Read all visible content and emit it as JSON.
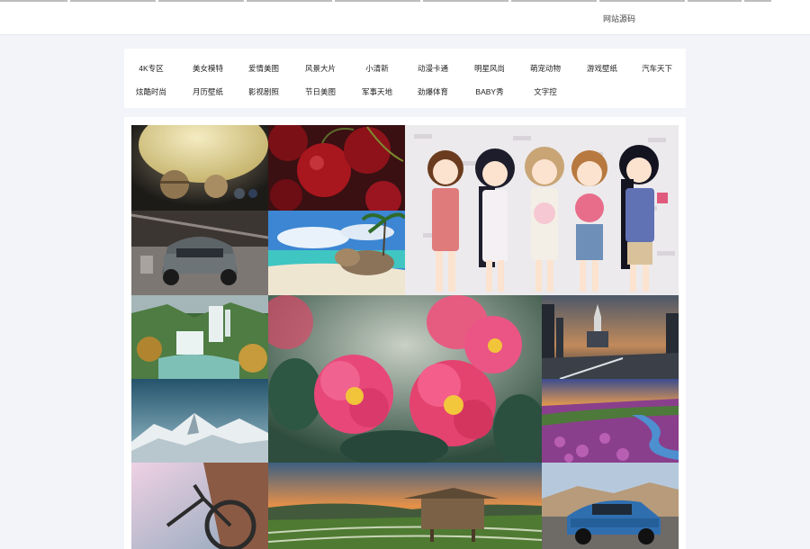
{
  "header": {
    "source_link": "网站源码"
  },
  "categories": [
    "4K专区",
    "美女模特",
    "爱情美图",
    "风景大片",
    "小清新",
    "动漫卡通",
    "明星风尚",
    "萌宠动物",
    "游戏壁纸",
    "汽车天下",
    "炫酷时尚",
    "月历壁纸",
    "影视剧照",
    "节日美图",
    "军事天地",
    "劲爆体育",
    "BABY秀",
    "文字控"
  ],
  "gallery": {
    "tiles": [
      {
        "name": "planets-wallpaper",
        "icon": "planets-image"
      },
      {
        "name": "cherries-wallpaper",
        "icon": "cherries-image"
      },
      {
        "name": "anime-girls-wallpaper",
        "icon": "anime-girls-image"
      },
      {
        "name": "sports-car-garage-wallpaper",
        "icon": "car-image"
      },
      {
        "name": "tropical-beach-wallpaper",
        "icon": "beach-image"
      },
      {
        "name": "waterfall-wallpaper",
        "icon": "waterfall-image"
      },
      {
        "name": "pink-camellia-wallpaper",
        "icon": "flower-image"
      },
      {
        "name": "rocket-launch-wallpaper",
        "icon": "rocket-image"
      },
      {
        "name": "snowy-mountains-wallpaper",
        "icon": "mountains-image"
      },
      {
        "name": "purple-flower-field-wallpaper",
        "icon": "flower-field-image"
      },
      {
        "name": "bicycle-wallpaper",
        "icon": "bicycle-image"
      },
      {
        "name": "rice-terrace-hut-wallpaper",
        "icon": "hut-image"
      },
      {
        "name": "blue-muscle-car-wallpaper",
        "icon": "car-image"
      }
    ]
  }
}
